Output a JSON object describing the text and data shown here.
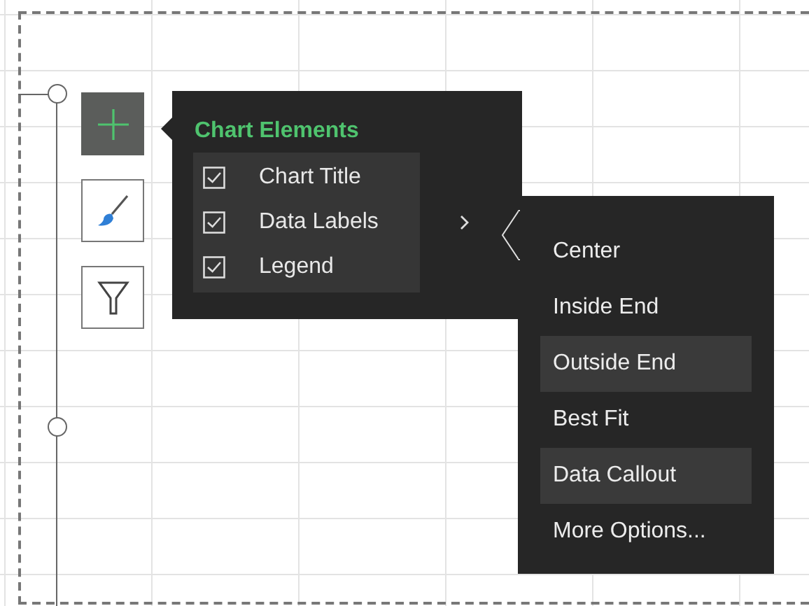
{
  "chart_buttons": [
    {
      "kind": "elements",
      "selected": true
    },
    {
      "kind": "styles",
      "selected": false
    },
    {
      "kind": "filters",
      "selected": false
    }
  ],
  "chart_elements": {
    "title": "Chart Elements",
    "items": [
      {
        "label": "Chart Title",
        "checked": true,
        "has_submenu": false
      },
      {
        "label": "Data Labels",
        "checked": true,
        "has_submenu": true
      },
      {
        "label": "Legend",
        "checked": true,
        "has_submenu": false
      }
    ]
  },
  "data_labels_menu": {
    "items": [
      {
        "label": "Center",
        "highlighted": false
      },
      {
        "label": "Inside End",
        "highlighted": false
      },
      {
        "label": "Outside End",
        "highlighted": true
      },
      {
        "label": "Best Fit",
        "highlighted": false
      },
      {
        "label": "Data Callout",
        "highlighted": true
      },
      {
        "label": "More Options...",
        "highlighted": false
      }
    ]
  }
}
